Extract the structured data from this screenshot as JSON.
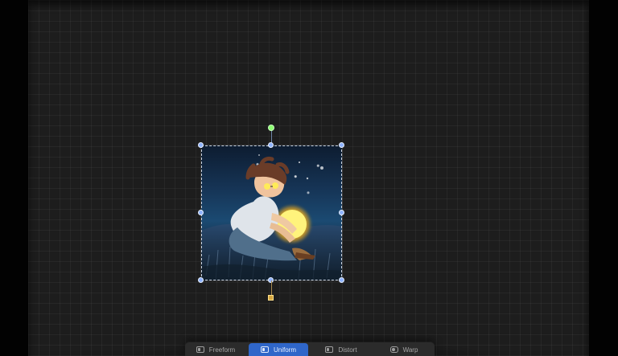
{
  "artwork": {
    "subject": "boy holding glowing moon"
  },
  "transform_modes": {
    "items": [
      {
        "label": "Freeform",
        "icon": "freeform-icon"
      },
      {
        "label": "Uniform",
        "icon": "uniform-icon",
        "selected": true
      },
      {
        "label": "Distort",
        "icon": "distort-icon"
      },
      {
        "label": "Warp",
        "icon": "warp-icon"
      }
    ]
  },
  "colors": {
    "canvas": "#1d1d1d",
    "selection": "#8fb3ff",
    "active_mode": "#2f66c9",
    "rotate_handle": "#8dff72",
    "pivot_handle": "#d5a741"
  }
}
